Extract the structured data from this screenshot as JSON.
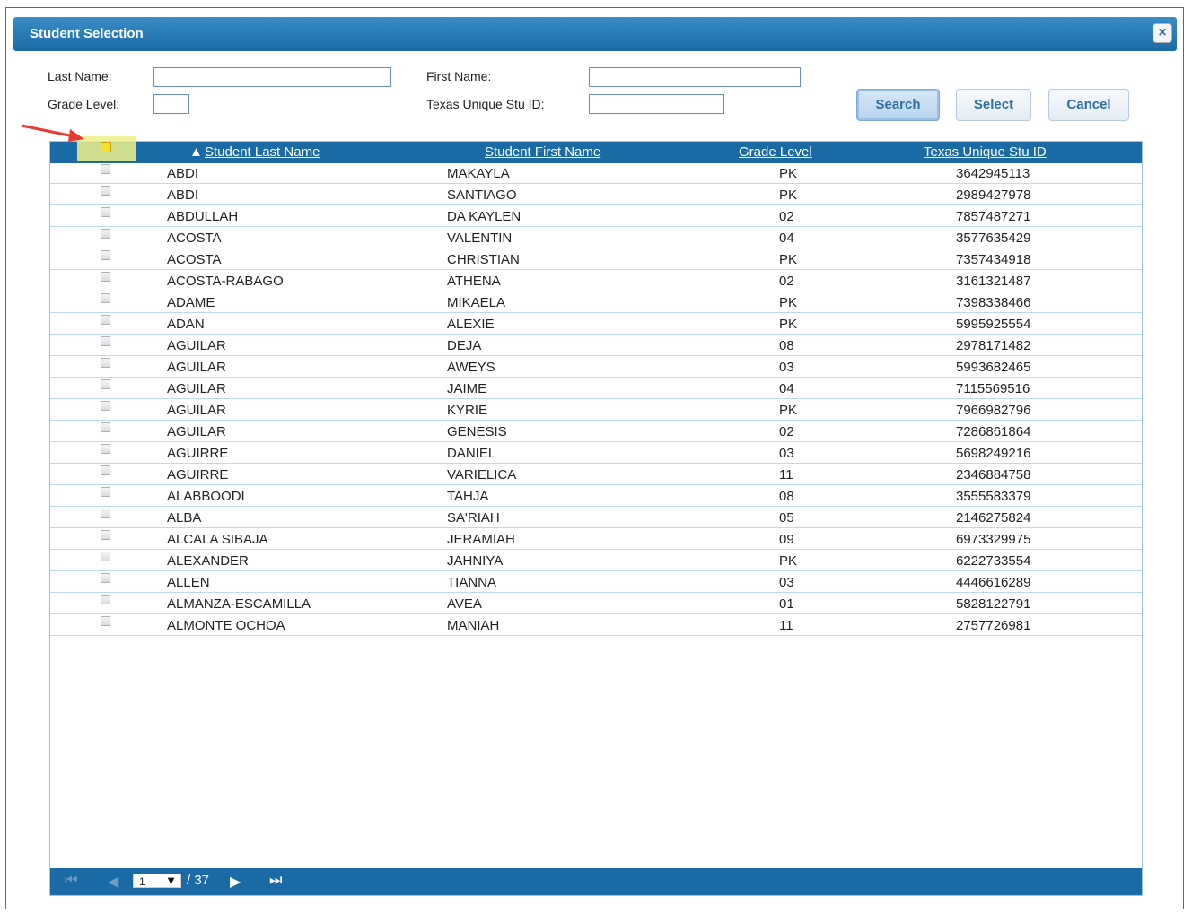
{
  "dialog": {
    "title": "Student Selection",
    "close_label": "×"
  },
  "filters": {
    "last_name_label": "Last Name:",
    "last_name_value": "",
    "first_name_label": "First Name:",
    "first_name_value": "",
    "grade_level_label": "Grade Level:",
    "grade_level_value": "",
    "texas_id_label": "Texas Unique Stu ID:",
    "texas_id_value": ""
  },
  "buttons": {
    "search": "Search",
    "select": "Select",
    "cancel": "Cancel"
  },
  "table": {
    "headers": {
      "sort_indicator": "▲",
      "last_name": "Student Last Name",
      "first_name": "Student First Name",
      "grade": "Grade Level",
      "texas_id": "Texas Unique Stu ID"
    },
    "rows": [
      {
        "last": "ABDI",
        "first": "MAKAYLA",
        "grade": "PK",
        "id": "3642945113"
      },
      {
        "last": "ABDI",
        "first": "SANTIAGO",
        "grade": "PK",
        "id": "2989427978"
      },
      {
        "last": "ABDULLAH",
        "first": "DA KAYLEN",
        "grade": "02",
        "id": "7857487271"
      },
      {
        "last": "ACOSTA",
        "first": "VALENTIN",
        "grade": "04",
        "id": "3577635429"
      },
      {
        "last": "ACOSTA",
        "first": "CHRISTIAN",
        "grade": "PK",
        "id": "7357434918"
      },
      {
        "last": "ACOSTA-RABAGO",
        "first": "ATHENA",
        "grade": "02",
        "id": "3161321487"
      },
      {
        "last": "ADAME",
        "first": "MIKAELA",
        "grade": "PK",
        "id": "7398338466"
      },
      {
        "last": "ADAN",
        "first": "ALEXIE",
        "grade": "PK",
        "id": "5995925554"
      },
      {
        "last": "AGUILAR",
        "first": "DEJA",
        "grade": "08",
        "id": "2978171482"
      },
      {
        "last": "AGUILAR",
        "first": "AWEYS",
        "grade": "03",
        "id": "5993682465"
      },
      {
        "last": "AGUILAR",
        "first": "JAIME",
        "grade": "04",
        "id": "7115569516"
      },
      {
        "last": "AGUILAR",
        "first": "KYRIE",
        "grade": "PK",
        "id": "7966982796"
      },
      {
        "last": "AGUILAR",
        "first": "GENESIS",
        "grade": "02",
        "id": "7286861864"
      },
      {
        "last": "AGUIRRE",
        "first": "DANIEL",
        "grade": "03",
        "id": "5698249216"
      },
      {
        "last": "AGUIRRE",
        "first": "VARIELICA",
        "grade": "11",
        "id": "2346884758"
      },
      {
        "last": "ALABBOODI",
        "first": "TAHJA",
        "grade": "08",
        "id": "3555583379"
      },
      {
        "last": "ALBA",
        "first": "SA'RIAH",
        "grade": "05",
        "id": "2146275824"
      },
      {
        "last": "ALCALA SIBAJA",
        "first": "JERAMIAH",
        "grade": "09",
        "id": "6973329975"
      },
      {
        "last": "ALEXANDER",
        "first": "JAHNIYA",
        "grade": "PK",
        "id": "6222733554"
      },
      {
        "last": "ALLEN",
        "first": "TIANNA",
        "grade": "03",
        "id": "4446616289"
      },
      {
        "last": "ALMANZA-ESCAMILLA",
        "first": "AVEA",
        "grade": "01",
        "id": "5828122791"
      },
      {
        "last": "ALMONTE OCHOA",
        "first": "MANIAH",
        "grade": "11",
        "id": "2757726981"
      }
    ]
  },
  "pager": {
    "first_icon": "first-page-icon",
    "prev_icon": "prev-page-icon",
    "next_icon": "next-page-icon",
    "last_icon": "last-page-icon",
    "current_page": "1",
    "total_pages": "/ 37"
  },
  "colors": {
    "header_blue": "#1a6aa6",
    "highlight_yellow": "#eef08a",
    "annotation_red": "#e53a2f"
  }
}
